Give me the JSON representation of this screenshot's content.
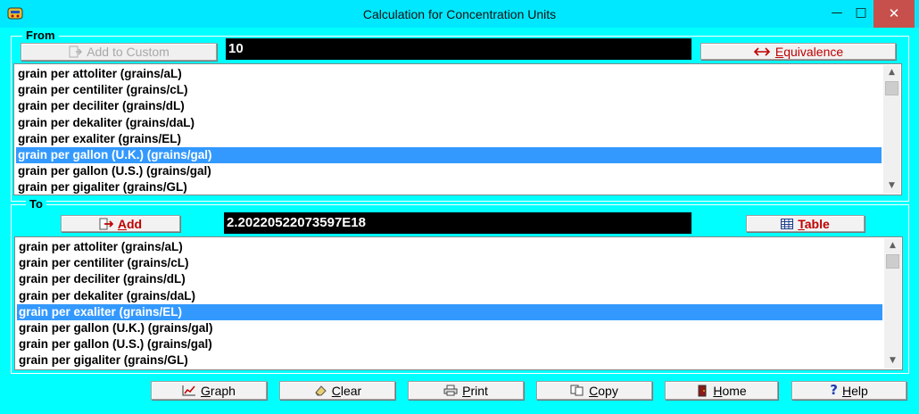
{
  "window": {
    "title": "Calculation for Concentration Units",
    "minimize_glyph": "—",
    "maximize_glyph": "□",
    "close_glyph": "✕"
  },
  "from": {
    "label": "From",
    "add_custom_label": "Add to Custom",
    "value": "10",
    "equivalence_label": "Equivalence",
    "items": [
      "grain per attoliter (grains/aL)",
      "grain per centiliter (grains/cL)",
      "grain per deciliter (grains/dL)",
      "grain per dekaliter (grains/daL)",
      "grain per exaliter (grains/EL)",
      "grain per gallon (U.K.) (grains/gal)",
      "grain per gallon (U.S.) (grains/gal)",
      "grain per gigaliter (grains/GL)"
    ],
    "selected_index": 5
  },
  "to": {
    "label": "To",
    "add_label": "Add",
    "value": "2.20220522073597E18",
    "table_label": "Table",
    "items": [
      "grain per attoliter (grains/aL)",
      "grain per centiliter (grains/cL)",
      "grain per deciliter (grains/dL)",
      "grain per dekaliter (grains/daL)",
      "grain per exaliter (grains/EL)",
      "grain per gallon (U.K.) (grains/gal)",
      "grain per gallon (U.S.) (grains/gal)",
      "grain per gigaliter (grains/GL)"
    ],
    "selected_index": 4
  },
  "bottom_buttons": {
    "graph": "Graph",
    "clear": "Clear",
    "print": "Print",
    "copy": "Copy",
    "home": "Home",
    "help": "Help"
  },
  "icons": {
    "add_custom": "document-add-icon",
    "equivalence": "double-arrow-icon",
    "add": "arrow-right-icon",
    "table": "table-icon",
    "graph": "chart-icon",
    "clear": "eraser-icon",
    "print": "printer-icon",
    "copy": "copy-icon",
    "home": "door-icon",
    "help": "question-icon"
  },
  "colors": {
    "background": "#00ffff",
    "selection": "#3399ff",
    "close_button": "#c7504c",
    "accent_red": "#c00000"
  }
}
